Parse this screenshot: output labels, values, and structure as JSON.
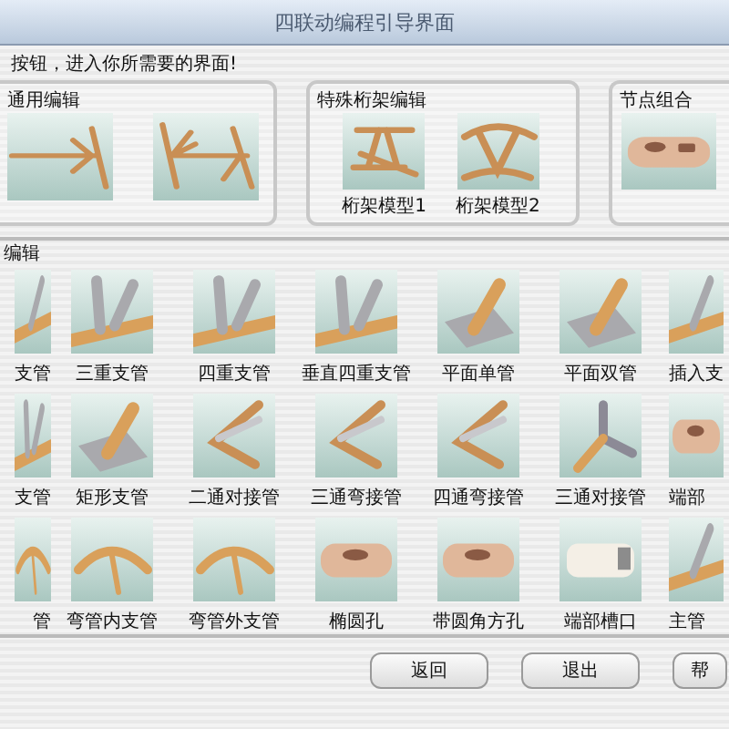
{
  "window": {
    "title": "四联动编程引导界面"
  },
  "instruction": "按钮，进入你所需要的界面!",
  "groups": [
    {
      "title": "通用编辑",
      "items": [
        {
          "kind": "arrow"
        },
        {
          "kind": "arrow2"
        }
      ]
    },
    {
      "title": "特殊桁架编辑",
      "items": [
        {
          "kind": "truss",
          "label": "桁架模型1"
        },
        {
          "kind": "arch",
          "label": "桁架模型2"
        }
      ]
    },
    {
      "title": "节点组合",
      "items": [
        {
          "kind": "tube"
        }
      ]
    }
  ],
  "editor": {
    "title": "编辑",
    "rows": [
      [
        {
          "kind": "branch",
          "label": "支管"
        },
        {
          "kind": "multi",
          "label": "三重支管"
        },
        {
          "kind": "multi",
          "label": "四重支管"
        },
        {
          "kind": "multi",
          "label": "垂直四重支管"
        },
        {
          "kind": "plate",
          "label": "平面单管"
        },
        {
          "kind": "plate",
          "label": "平面双管"
        },
        {
          "kind": "branch",
          "label": "插入支"
        }
      ],
      [
        {
          "kind": "multi",
          "label": "支管"
        },
        {
          "kind": "plate",
          "label": "矩形支管"
        },
        {
          "kind": "elbow",
          "label": "二通对接管"
        },
        {
          "kind": "elbow",
          "label": "三通弯接管"
        },
        {
          "kind": "elbow",
          "label": "四通弯接管"
        },
        {
          "kind": "tee",
          "label": "三通对接管"
        },
        {
          "kind": "tube",
          "label": "端部"
        }
      ],
      [
        {
          "kind": "arc",
          "label": "管"
        },
        {
          "kind": "arc",
          "label": "弯管内支管"
        },
        {
          "kind": "arc",
          "label": "弯管外支管"
        },
        {
          "kind": "tube",
          "label": "椭圆孔"
        },
        {
          "kind": "tube",
          "label": "带圆角方孔"
        },
        {
          "kind": "slot",
          "label": "端部槽口"
        },
        {
          "kind": "branch",
          "label": "主管"
        }
      ]
    ]
  },
  "buttons": [
    "返回",
    "退出",
    "帮"
  ]
}
